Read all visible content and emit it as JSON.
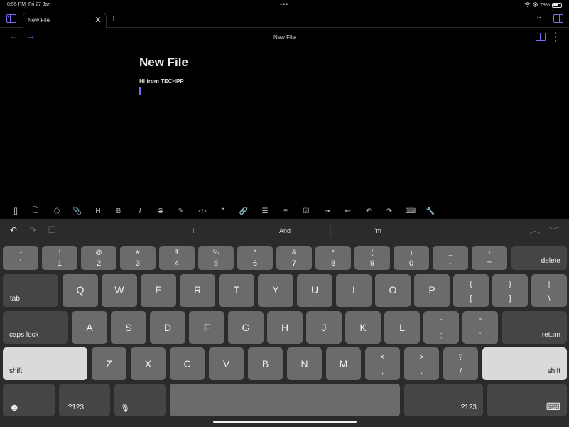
{
  "status_bar": {
    "time": "8:55 PM",
    "date": "Fri 27 Jan",
    "battery_percent_label": "73%",
    "battery_level": 0.73,
    "icons": [
      "wifi-icon",
      "orientation-lock-icon",
      "battery-icon"
    ]
  },
  "tab_bar": {
    "tabs": [
      {
        "label": "New File",
        "active": true
      }
    ],
    "close_glyph": "✕",
    "new_tab_glyph": "+",
    "chevron_glyph": "⌄"
  },
  "nav": {
    "back_glyph": "←",
    "forward_glyph": "→",
    "title": "New File"
  },
  "editor": {
    "title": "New File",
    "lines": [
      "Hi from TECHPP"
    ]
  },
  "format_toolbar": {
    "accent": "#7b6cf0",
    "buttons": [
      {
        "name": "internal-link",
        "glyph": "[]"
      },
      {
        "name": "embed-file",
        "glyph": "🗋"
      },
      {
        "name": "tag",
        "glyph": "⬠"
      },
      {
        "name": "attachment",
        "glyph": "📎"
      },
      {
        "name": "heading",
        "glyph": "H"
      },
      {
        "name": "bold",
        "glyph": "B"
      },
      {
        "name": "italic",
        "glyph": "I"
      },
      {
        "name": "strikethrough",
        "glyph": "S"
      },
      {
        "name": "highlight",
        "glyph": "✎"
      },
      {
        "name": "code",
        "glyph": "</>"
      },
      {
        "name": "quote",
        "glyph": "❞"
      },
      {
        "name": "link",
        "glyph": "🔗"
      },
      {
        "name": "bullet-list",
        "glyph": "☰"
      },
      {
        "name": "numbered-list",
        "glyph": "≡"
      },
      {
        "name": "checklist",
        "glyph": "☑"
      },
      {
        "name": "indent",
        "glyph": "⇥"
      },
      {
        "name": "outdent",
        "glyph": "⇤"
      },
      {
        "name": "undo",
        "glyph": "↶"
      },
      {
        "name": "redo",
        "glyph": "↷"
      },
      {
        "name": "hide-keyboard",
        "glyph": "⌨"
      },
      {
        "name": "settings-wrench",
        "glyph": "🔧"
      }
    ]
  },
  "keyboard": {
    "suggestion_bar": {
      "undo_glyph": "↶",
      "redo_glyph": "↷",
      "paste_glyph": "❐",
      "suggestions": [
        "I",
        "And",
        "I'm"
      ],
      "up_glyph": "︿",
      "down_glyph": "﹀"
    },
    "row_numbers": [
      {
        "top": "~",
        "bottom": "`"
      },
      {
        "top": "!",
        "bottom": "1"
      },
      {
        "top": "@",
        "bottom": "2"
      },
      {
        "top": "#",
        "bottom": "3"
      },
      {
        "top": "₹",
        "bottom": "4"
      },
      {
        "top": "%",
        "bottom": "5"
      },
      {
        "top": "^",
        "bottom": "6"
      },
      {
        "top": "&",
        "bottom": "7"
      },
      {
        "top": "*",
        "bottom": "8"
      },
      {
        "top": "(",
        "bottom": "9"
      },
      {
        "top": ")",
        "bottom": "0"
      },
      {
        "top": "_",
        "bottom": "-"
      },
      {
        "top": "+",
        "bottom": "="
      }
    ],
    "delete_label": "delete",
    "tab_label": "tab",
    "row_qwerty": [
      "Q",
      "W",
      "E",
      "R",
      "T",
      "Y",
      "U",
      "I",
      "O",
      "P"
    ],
    "row_qwerty_symbols": [
      {
        "top": "{",
        "bottom": "["
      },
      {
        "top": "}",
        "bottom": "]"
      },
      {
        "top": "|",
        "bottom": "\\"
      }
    ],
    "caps_lock_label": "caps lock",
    "row_asdf": [
      "A",
      "S",
      "D",
      "F",
      "G",
      "H",
      "J",
      "K",
      "L"
    ],
    "row_asdf_symbols": [
      {
        "top": ":",
        "bottom": ";"
      },
      {
        "top": "\"",
        "bottom": "'"
      }
    ],
    "return_label": "return",
    "shift_label": "shift",
    "row_zxcv": [
      "Z",
      "X",
      "C",
      "V",
      "B",
      "N",
      "M"
    ],
    "row_zxcv_symbols": [
      {
        "top": "<",
        "bottom": ","
      },
      {
        "top": ">",
        "bottom": "."
      },
      {
        "top": "?",
        "bottom": "/"
      }
    ],
    "emoji_glyph": "☻",
    "numbers_label": ".?123",
    "mic_glyph": "🎙",
    "space_label": "",
    "dismiss_glyph": "⌨"
  }
}
